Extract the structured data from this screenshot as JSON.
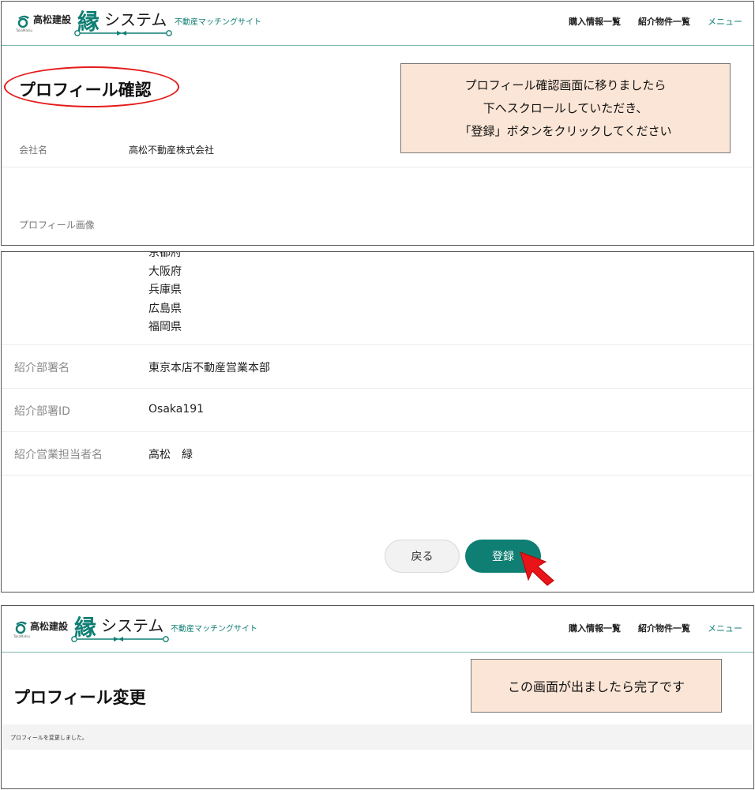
{
  "header": {
    "corp_name": "高松建設",
    "corp_sub": "TakaMatsu",
    "logo_kanji": "縁",
    "logo_system": "システム",
    "tagline": "不動産マッチングサイト",
    "nav": [
      "購入情報一覧",
      "紹介物件一覧",
      "メニュー"
    ],
    "brand_color": "#0f7e73"
  },
  "confirm": {
    "title": "プロフィール確認",
    "note_lines": [
      "プロフィール確認画面に移りましたら",
      "下へスクロールしていただき、",
      "「登録」ボタンをクリックしてください"
    ],
    "company_label": "会社名",
    "company_value": "高松不動産株式会社",
    "image_label": "プロフィール画像"
  },
  "details": {
    "prefectures_cut": "京都府",
    "prefectures": [
      "大阪府",
      "兵庫県",
      "広島県",
      "福岡県"
    ],
    "rows": [
      {
        "label": "紹介部署名",
        "value": "東京本店不動産営業本部"
      },
      {
        "label": "紹介部署ID",
        "value": "Osaka191"
      },
      {
        "label": "紹介営業担当者名",
        "value": "高松　緑"
      }
    ],
    "back_label": "戻る",
    "register_label": "登録"
  },
  "done": {
    "title": "プロフィール変更",
    "note": "この画面が出ましたら完了です",
    "message": "プロフィールを変更しました。"
  }
}
